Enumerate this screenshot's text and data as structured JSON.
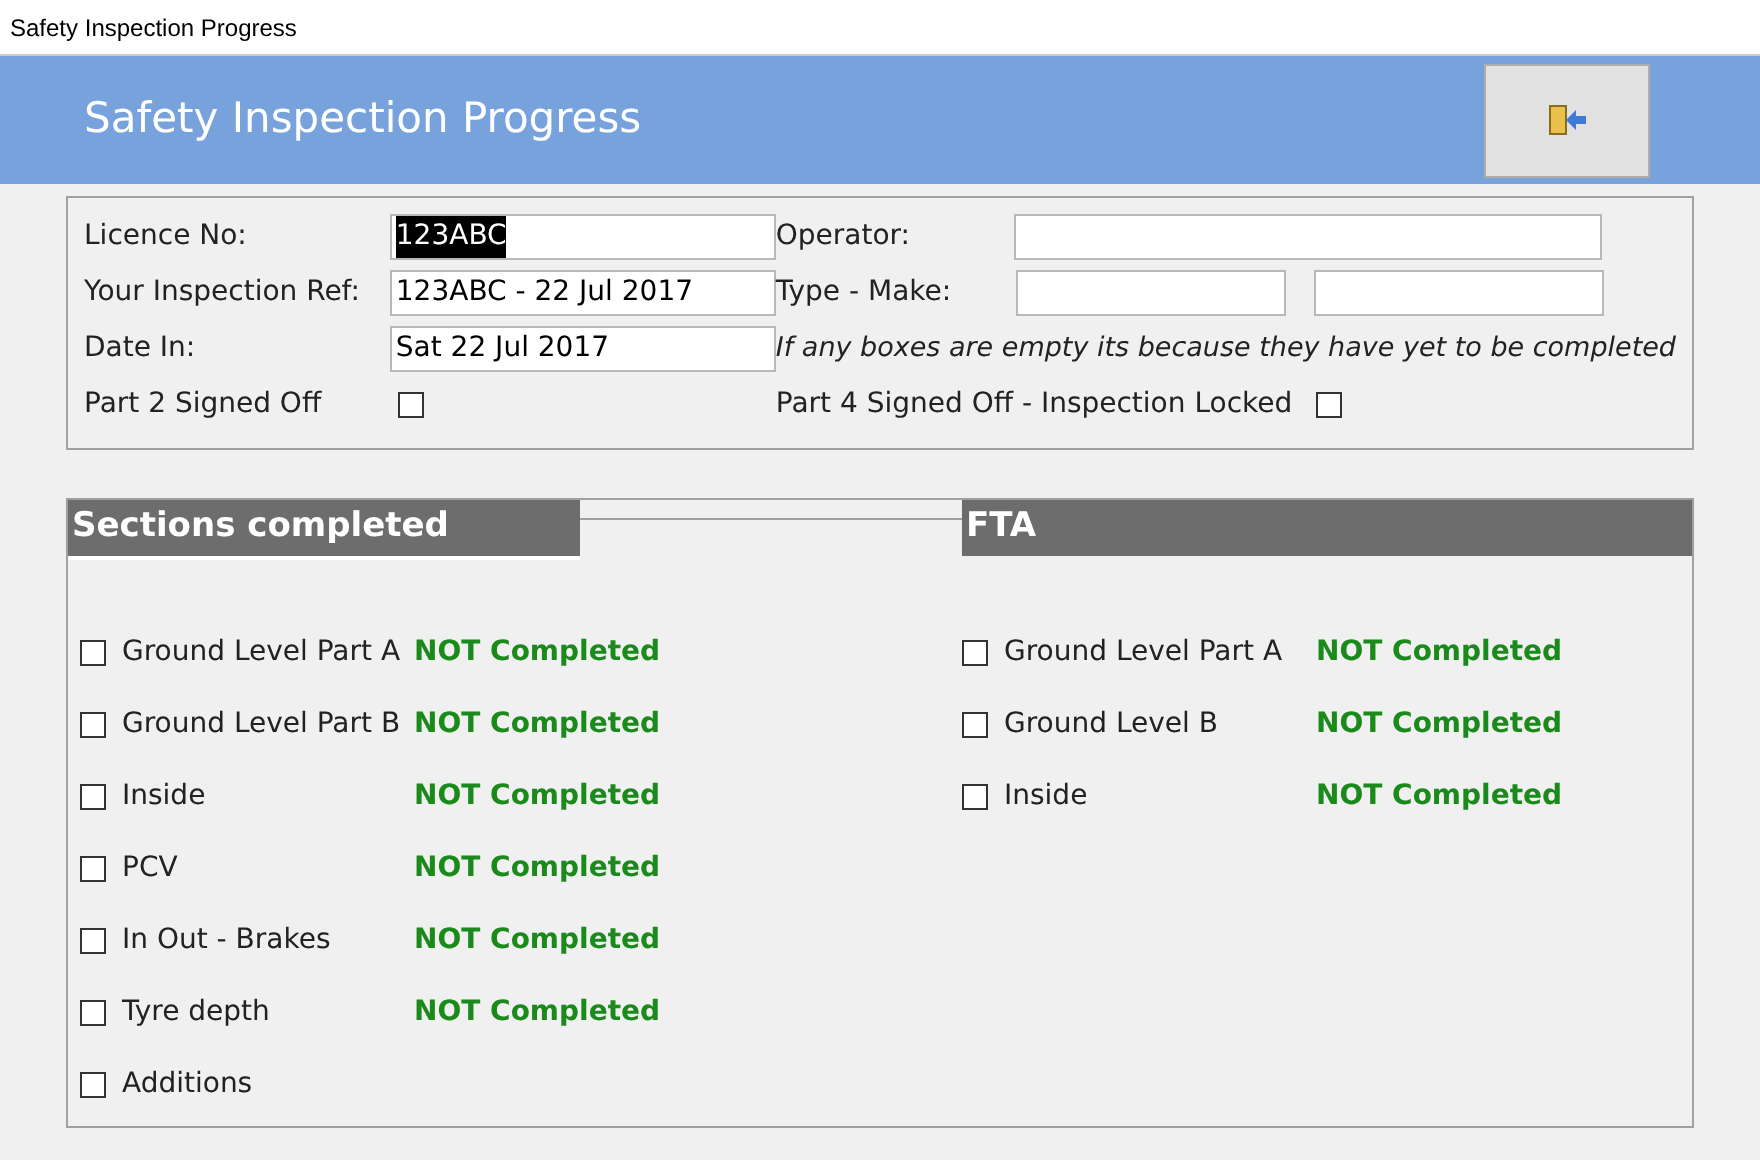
{
  "window": {
    "title": "Safety Inspection Progress"
  },
  "header": {
    "title": "Safety Inspection Progress"
  },
  "details": {
    "licence": {
      "label": "Licence No:",
      "value": "123ABC",
      "value_selected": true
    },
    "inspection_ref": {
      "label": "Your Inspection Ref:",
      "value": "123ABC - 22 Jul 2017"
    },
    "date_in": {
      "label": "Date In:",
      "value": "Sat 22 Jul 2017"
    },
    "part2": {
      "label": "Part 2 Signed Off",
      "checked": false
    },
    "operator": {
      "label": "Operator:"
    },
    "type_make": {
      "label": "Type - Make:"
    },
    "note": "If any boxes are empty its because they have yet to be completed",
    "part4": {
      "label": "Part 4 Signed Off - Inspection Locked",
      "checked": false
    }
  },
  "sections": {
    "title": "Sections completed",
    "items": [
      {
        "label": "Ground Level Part A",
        "checked": false,
        "status": "NOT Completed"
      },
      {
        "label": "Ground Level Part B",
        "checked": false,
        "status": "NOT Completed"
      },
      {
        "label": "Inside",
        "checked": false,
        "status": "NOT Completed"
      },
      {
        "label": "PCV",
        "checked": false,
        "status": "NOT Completed"
      },
      {
        "label": "In Out - Brakes",
        "checked": false,
        "status": "NOT Completed"
      },
      {
        "label": "Tyre depth",
        "checked": false,
        "status": "NOT Completed"
      },
      {
        "label": "Additions",
        "checked": false
      }
    ]
  },
  "fta": {
    "title": "FTA",
    "items": [
      {
        "label": "Ground Level Part A",
        "checked": false,
        "status": "NOT Completed"
      },
      {
        "label": "Ground Level B",
        "checked": false,
        "status": "NOT Completed"
      },
      {
        "label": "Inside",
        "checked": false,
        "status": "NOT Completed"
      }
    ]
  }
}
